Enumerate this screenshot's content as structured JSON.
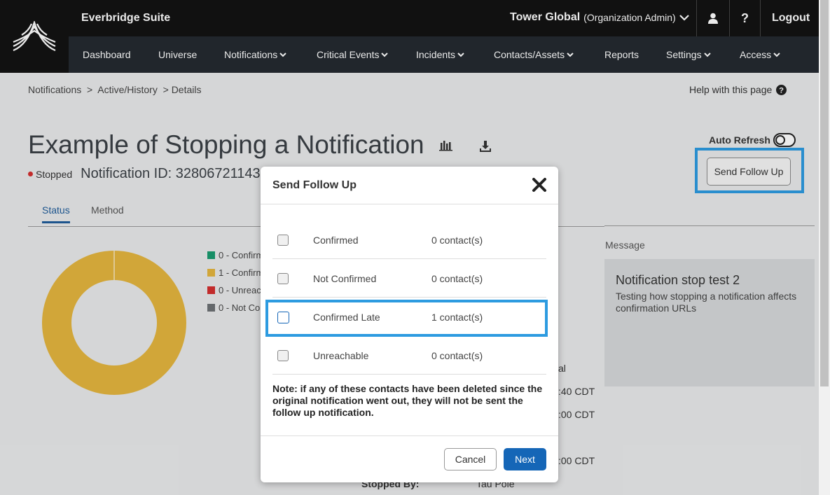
{
  "app": {
    "suite_name": "Everbridge Suite",
    "org_name": "Tower Global",
    "org_role": "(Organization Admin)",
    "help_glyph": "?",
    "logout_label": "Logout"
  },
  "nav": {
    "items": [
      {
        "label": "Dashboard",
        "dropdown": false
      },
      {
        "label": "Universe",
        "dropdown": false
      },
      {
        "label": "Notifications",
        "dropdown": true
      },
      {
        "label": "Critical Events",
        "dropdown": true
      },
      {
        "label": "Incidents",
        "dropdown": true
      },
      {
        "label": "Contacts/Assets",
        "dropdown": true
      },
      {
        "label": "Reports",
        "dropdown": false
      },
      {
        "label": "Settings",
        "dropdown": true
      },
      {
        "label": "Access",
        "dropdown": true
      }
    ]
  },
  "breadcrumb": {
    "items": [
      "Notifications",
      "Active/History"
    ],
    "separator": ">",
    "current": "Details"
  },
  "help_link": "Help with this page",
  "page": {
    "title": "Example of Stopping a Notification",
    "status": "Stopped",
    "notification_id": "Notification ID: 32806721143",
    "auto_refresh_label": "Auto Refresh",
    "auto_refresh_on": false,
    "send_follow_up_label": "Send Follow Up"
  },
  "tabs": [
    {
      "label": "Status",
      "active": true
    },
    {
      "label": "Method",
      "active": false
    }
  ],
  "chart_data": {
    "type": "pie",
    "categories": [
      "Confirmed",
      "Confirmed Late",
      "Unreachable",
      "Not Confirmed"
    ],
    "values": [
      0,
      1,
      0,
      0
    ],
    "colors": [
      "#1a9b6f",
      "#e3b53e",
      "#d32f2f",
      "#6d7175"
    ]
  },
  "legend": {
    "items": [
      "0 - Confirm",
      "1 - Confirm",
      "0 - Unreac",
      "0 - Not Co"
    ]
  },
  "message": {
    "label": "Message",
    "title": "Notification stop test 2",
    "body": "Testing how stopping a notification affects confirmation URLs"
  },
  "details_partial": {
    "col_right_1": "al",
    "time_1": ":40 CDT",
    "time_2": ":00 CDT",
    "time_3": ":00 CDT",
    "stopped_by_label": "Stopped By:",
    "stopped_by_value": "Tau Pole"
  },
  "modal": {
    "title": "Send Follow Up",
    "rows": [
      {
        "label": "Confirmed",
        "count": "0 contact(s)",
        "checked": false
      },
      {
        "label": "Not Confirmed",
        "count": "0 contact(s)",
        "checked": false
      },
      {
        "label": "Confirmed Late",
        "count": "1 contact(s)",
        "checked": false
      },
      {
        "label": "Unreachable",
        "count": "0 contact(s)",
        "checked": false
      }
    ],
    "note": "Note: if any of these contacts have been deleted since the original notification went out, they will not be sent the follow up notification.",
    "cancel_label": "Cancel",
    "next_label": "Next"
  },
  "colors": {
    "accent": "#1566b7",
    "highlight": "#2d9be0",
    "top_bar": "#131313",
    "nav_bar": "#242a30"
  },
  "icons": {
    "logo": "everbridge-logo",
    "user": "user-icon",
    "help": "question-icon",
    "chart": "bar-chart-icon",
    "download": "download-icon",
    "close": "close-icon"
  }
}
